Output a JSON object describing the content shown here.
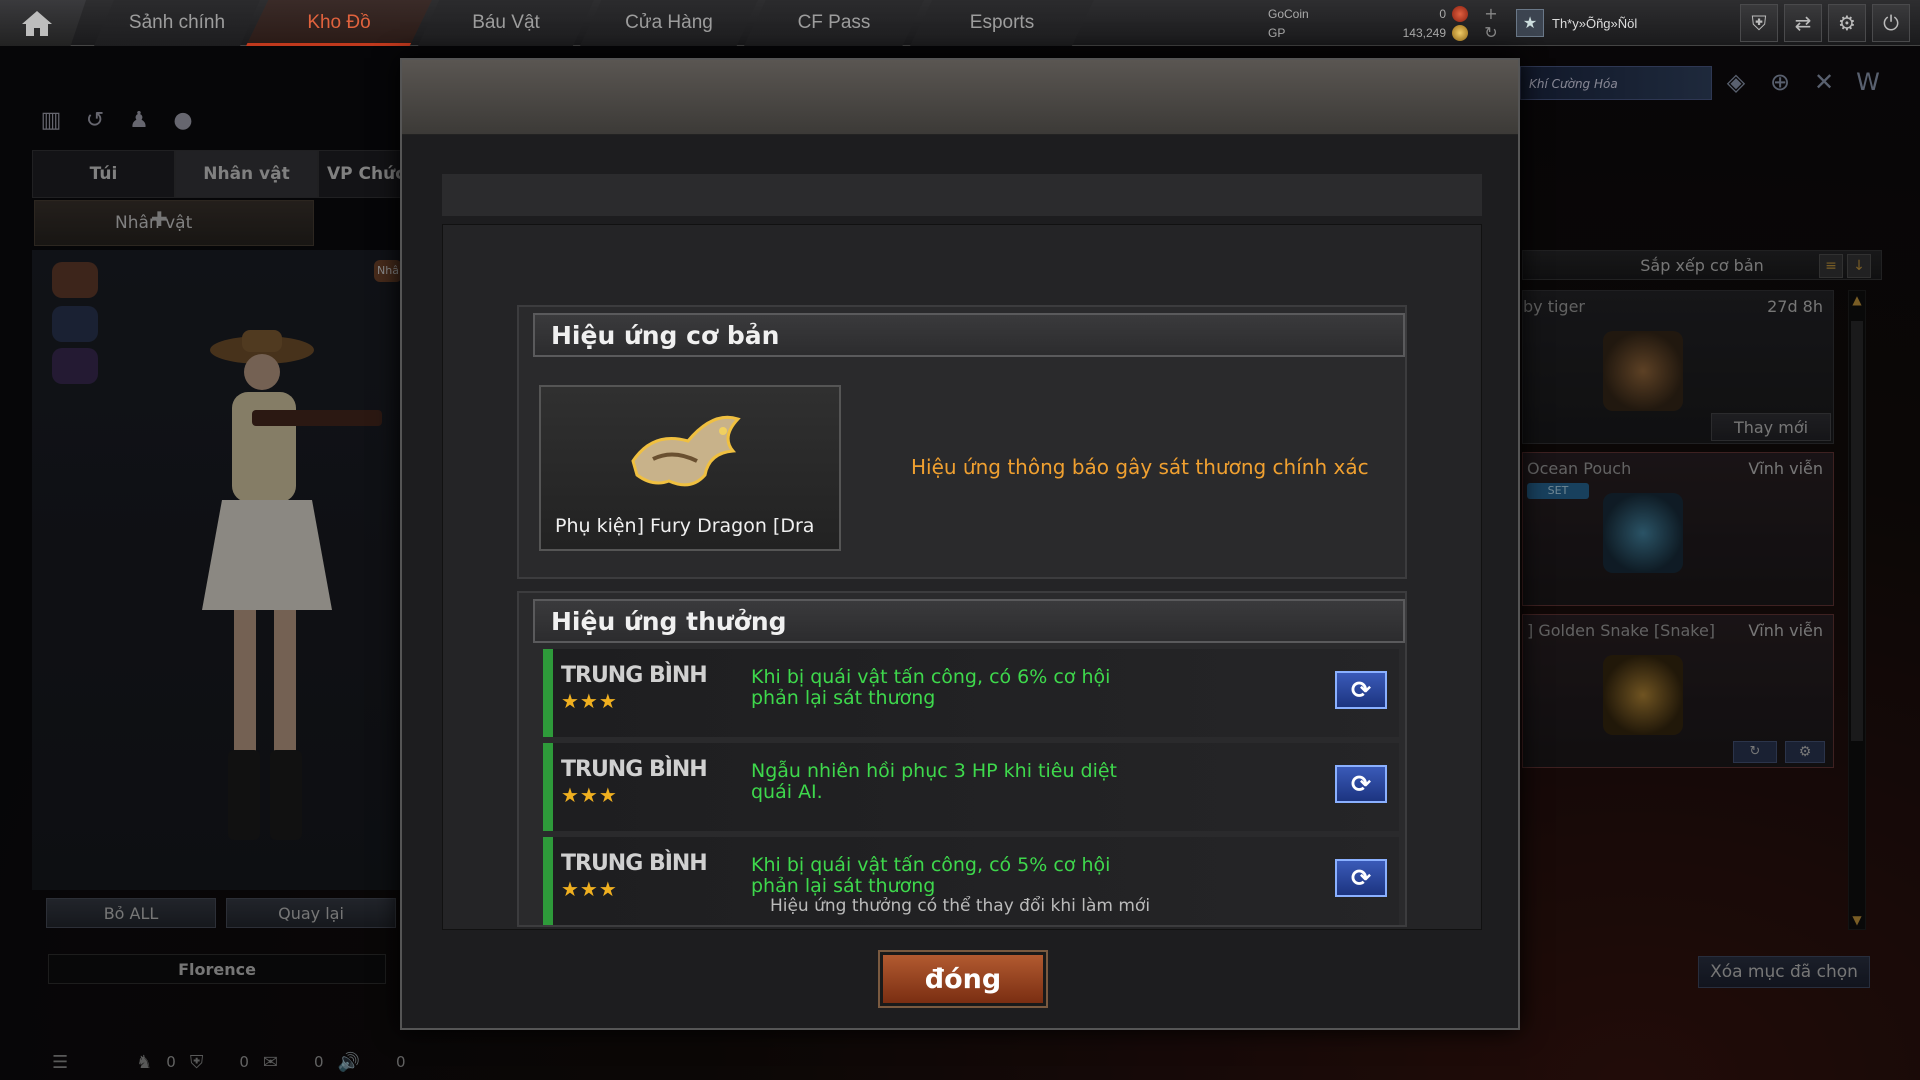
{
  "nav": {
    "tabs": [
      "Sảnh chính",
      "Kho Đồ",
      "Báu Vật",
      "Cửa Hàng",
      "CF Pass",
      "Esports"
    ],
    "active_tab": "Kho Đồ"
  },
  "currency": {
    "gocoin_label": "GoCoin",
    "gocoin_value": "0",
    "gp_label": "GP",
    "gp_value": "143,249"
  },
  "player": {
    "name": "Th*y»Õñg»Ñöl"
  },
  "left_panel": {
    "tabs": [
      "Túi",
      "Nhân vật",
      "VP Chức"
    ],
    "active_tab": "Nhân vật",
    "sub_tab": "Nhân vật",
    "button_bo_all": "Bỏ ALL",
    "button_quay_lai": "Quay lại",
    "character_name": "Florence",
    "slot_badge": "Nhâ"
  },
  "right_panel": {
    "banner": "Khí Cường Hóa",
    "sort_label": "Sắp xếp cơ bản",
    "items": [
      {
        "name": "by tiger",
        "time": "27d 8h",
        "action": "Thay mới"
      },
      {
        "name": "Ocean Pouch",
        "time": "Vĩnh viễn",
        "tag": "SET"
      },
      {
        "name": "] Golden Snake [Snake]",
        "time": "Vĩnh viễn"
      }
    ],
    "clear_button": "Xóa mục đã chọn"
  },
  "status_bar": {
    "values": [
      "0",
      "0",
      "0",
      "0"
    ]
  },
  "modal": {
    "base_section_title": "Hiệu ứng cơ bản",
    "item_label": "Phụ kiện] Fury Dragon [Dra",
    "base_effect": "Hiệu ứng thông báo gây sát thương chính xác",
    "bonus_section_title": "Hiệu ứng thưởng",
    "effects": [
      {
        "grade": "TRUNG BÌNH",
        "stars": "★★★",
        "line1": "Khi bị quái vật tấn công, có 6% cơ hội",
        "line2": "phản lại sát thương"
      },
      {
        "grade": "TRUNG BÌNH",
        "stars": "★★★",
        "line1": "Ngẫu nhiên hồi phục 3 HP khi tiêu diệt",
        "line2": "quái AI."
      },
      {
        "grade": "TRUNG BÌNH",
        "stars": "★★★",
        "line1": "Khi bị quái vật tấn công, có 5% cơ hội",
        "line2": "phản lại sát thương"
      }
    ],
    "note": "Hiệu ứng thưởng có thể thay đổi khi làm mới",
    "close_label": "đóng"
  },
  "colors": {
    "accent_orange": "#f0a030",
    "effect_green": "#3ed84c",
    "active_tab": "#e0623d",
    "refresh_blue": "#2a48a0"
  }
}
